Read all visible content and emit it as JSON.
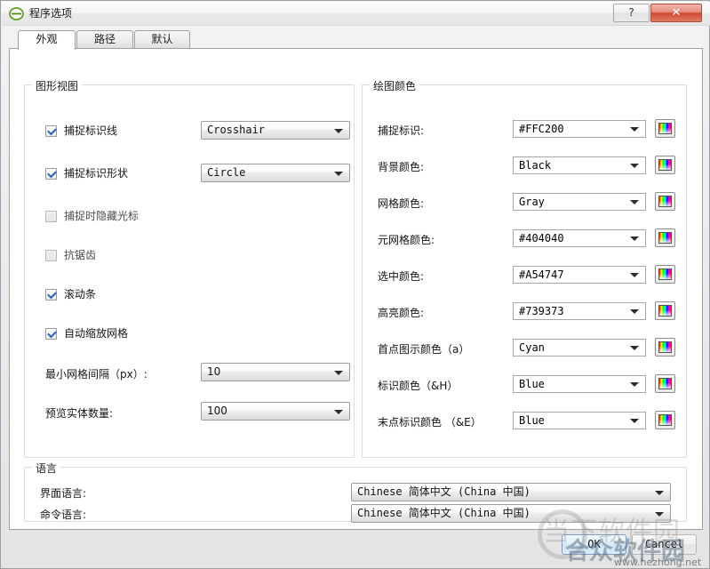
{
  "window": {
    "title": "程序选项",
    "icon": "ellipse-green-icon",
    "help_label": "?",
    "close_label": "✕"
  },
  "tabs": [
    {
      "label": "外观",
      "active": true
    },
    {
      "label": "路径",
      "active": false
    },
    {
      "label": "默认",
      "active": false
    }
  ],
  "graphics_view": {
    "title": "图形视图",
    "checkboxes": [
      {
        "label": "捕捉标识线",
        "checked": true
      },
      {
        "label": "捕捉标识形状",
        "checked": true
      },
      {
        "label": "捕捉时隐藏光标",
        "checked": false
      },
      {
        "label": "抗锯齿",
        "checked": false
      },
      {
        "label": "滚动条",
        "checked": true
      },
      {
        "label": "自动缩放网格",
        "checked": true
      }
    ],
    "combos": [
      {
        "value": "Crosshair"
      },
      {
        "value": "Circle"
      }
    ],
    "fields": [
      {
        "label": "最小网格间隔（px）:",
        "value": "10"
      },
      {
        "label": "预览实体数量:",
        "value": "100"
      }
    ]
  },
  "draw_colors": {
    "title": "绘图颜色",
    "rows": [
      {
        "label": "捕捉标识:",
        "value": "#FFC200"
      },
      {
        "label": "背景颜色:",
        "value": "Black"
      },
      {
        "label": "网格颜色:",
        "value": "Gray"
      },
      {
        "label": "元网格颜色:",
        "value": "#404040"
      },
      {
        "label": "选中颜色:",
        "value": "#A54747"
      },
      {
        "label": "高亮颜色:",
        "value": "#739373"
      },
      {
        "label": "首点图示颜色（a）",
        "value": "Cyan"
      },
      {
        "label": "标识颜色（&H）",
        "value": "Blue"
      },
      {
        "label": "末点标识颜色 （&E）",
        "value": "Blue"
      }
    ],
    "swatch_name": "color-picker-button"
  },
  "language": {
    "title": "语言",
    "rows": [
      {
        "label": "界面语言:",
        "value": "Chinese 简体中文 (China 中国)"
      },
      {
        "label": "命令语言:",
        "value": "Chinese 简体中文 (China 中国)"
      }
    ]
  },
  "footer": {
    "ok_label": "OK",
    "cancel_label": "Cancel"
  },
  "watermark": {
    "line1": "当下软件园",
    "line2": "合众软件园",
    "url": "www.hezhong.net"
  }
}
